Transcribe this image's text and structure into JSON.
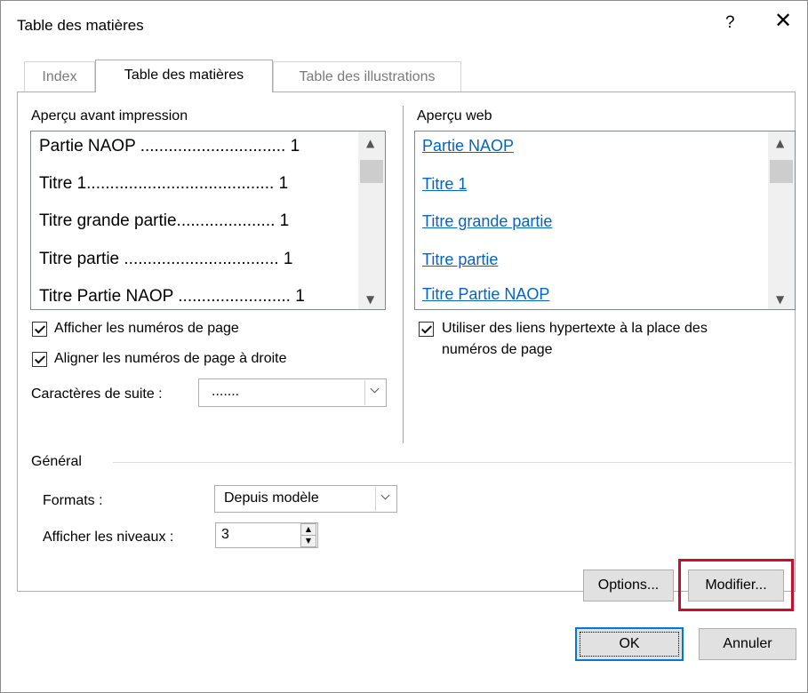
{
  "dialog": {
    "title": "Table des matières",
    "help_label": "?",
    "close_label": "✕"
  },
  "tabs": [
    {
      "label": "Index",
      "active": false
    },
    {
      "label": "Table des matières",
      "active": true
    },
    {
      "label": "Table des illustrations",
      "active": false
    }
  ],
  "print_preview": {
    "label": "Aperçu avant impression",
    "rows": [
      "Partie NAOP ............................... 1",
      "Titre 1........................................ 1",
      "Titre grande partie..................... 1",
      "Titre partie ................................. 1",
      "Titre Partie NAOP ........................ 1"
    ],
    "show_page_numbers": {
      "label": "Afficher les numéros de page",
      "checked": true
    },
    "align_page_numbers": {
      "label": "Aligner les numéros de page à droite",
      "checked": true
    },
    "tab_leader": {
      "label": "Caractères de suite :",
      "value": "......."
    }
  },
  "web_preview": {
    "label": "Aperçu web",
    "rows": [
      "Partie NAOP",
      "Titre 1",
      "Titre grande partie",
      "Titre partie",
      "Titre Partie NAOP"
    ],
    "use_hyperlinks": {
      "label_line1": "Utiliser des liens hypertexte à la place des",
      "label_line2": "numéros de page",
      "checked": true
    }
  },
  "general": {
    "label": "Général",
    "formats": {
      "label": "Formats :",
      "value": "Depuis modèle"
    },
    "levels": {
      "label": "Afficher les niveaux :",
      "value": "3"
    }
  },
  "buttons": {
    "options": "Options...",
    "modify": "Modifier...",
    "ok": "OK",
    "cancel": "Annuler"
  },
  "colors": {
    "highlight": "#c8102e",
    "link": "#0563c1",
    "focus": "#0078d7"
  }
}
